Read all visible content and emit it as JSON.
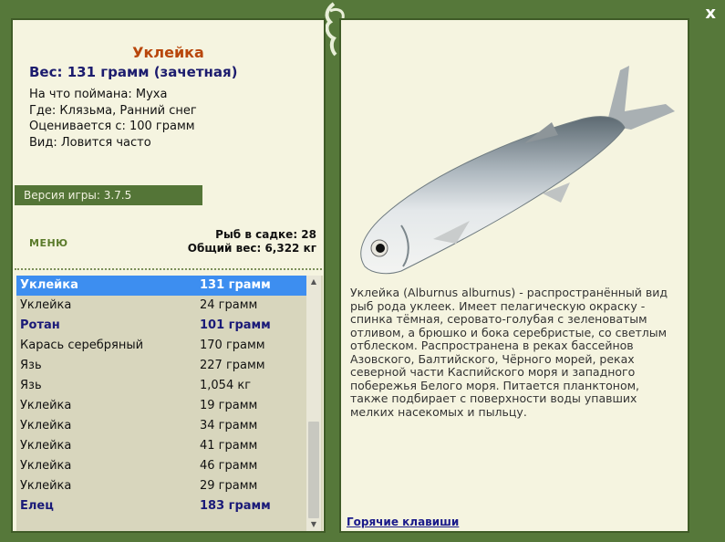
{
  "window": {
    "close_label": "x"
  },
  "fish": {
    "title": "Уклейка",
    "weight": "Вес: 131 грамм (зачетная)",
    "info": [
      "На что поймана: Муха",
      "Где: Клязьма, Ранний снег",
      "Оценивается с: 100 грамм",
      "Вид: Ловится часто"
    ]
  },
  "version": "Версия игры: 3.7.5",
  "menu_label": "МЕНЮ",
  "summary": {
    "count": "Рыб в садке: 28",
    "total": "Общий вес: 6,322 кг"
  },
  "catch_list": [
    {
      "name": "Уклейка",
      "weight": "131 грамм",
      "style": "sel"
    },
    {
      "name": "Уклейка",
      "weight": "24 грамм",
      "style": ""
    },
    {
      "name": "Ротан",
      "weight": "101 грамм",
      "style": "bold"
    },
    {
      "name": "Карась серебряный",
      "weight": "170 грамм",
      "style": ""
    },
    {
      "name": "Язь",
      "weight": "227 грамм",
      "style": ""
    },
    {
      "name": "Язь",
      "weight": "1,054 кг",
      "style": ""
    },
    {
      "name": "Уклейка",
      "weight": "19 грамм",
      "style": ""
    },
    {
      "name": "Уклейка",
      "weight": "34 грамм",
      "style": ""
    },
    {
      "name": "Уклейка",
      "weight": "41 грамм",
      "style": ""
    },
    {
      "name": "Уклейка",
      "weight": "46 грамм",
      "style": ""
    },
    {
      "name": "Уклейка",
      "weight": "29 грамм",
      "style": ""
    },
    {
      "name": "Елец",
      "weight": "183 грамм",
      "style": "bold"
    }
  ],
  "description": "Уклейка (Alburnus alburnus) - распространённый вид рыб рода уклеек. Имеет пелагическую окраску - спинка тёмная, серовато-голубая с зеленоватым отливом, а брюшко и бока серебристые, со светлым отблеском. Распространена в реках бассейнов Азовского, Балтийского, Чёрного морей, реках северной части Каспийского моря и западного побережья Белого моря. Питается планктоном, также подбирает с поверхности воды упавших мелких насекомых и пыльцу.",
  "hotkeys_label": "Горячие клавиши",
  "colors": {
    "frame": "#56783a",
    "panel": "#f5f4e0",
    "accent_title": "#b8460b",
    "selection": "#3d8ef0"
  }
}
